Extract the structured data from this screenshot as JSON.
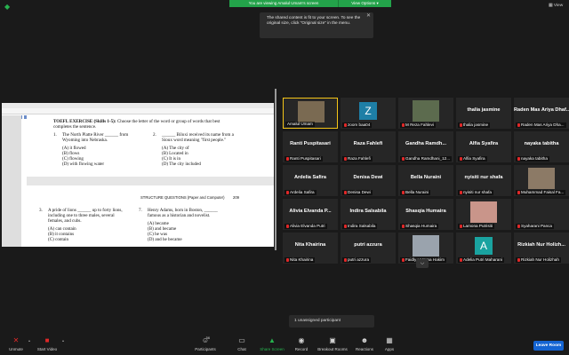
{
  "top": {
    "banner": "You are viewing Amalul Umam's screen",
    "view_options": "View Options ▾",
    "view": "View",
    "tooltip": "The shared content is fit to your screen. To see the original size, click \"Original size\" in the menu."
  },
  "doc": {
    "title_bold": "TOEFL EXERCISE (Skills 1-5):",
    "title_rest": "Choose the letter of the word or group of words that best",
    "title_line2": "completes the sentence.",
    "q1": [
      "1.",
      "The North Platte River ______ from",
      "Wyoming into Nebraska."
    ],
    "q1_opts": [
      "(A)  it flowed",
      "(B)  flows",
      "(C)  flowing",
      "(D)  with flowing water"
    ],
    "q2": [
      "2.",
      "______ Biloxi received its name from a",
      "Sioux word meaning \"first people.\""
    ],
    "q2_opts": [
      "(A)  The city of",
      "(B)  Located in",
      "(C)  It is in",
      "(D)  The city included"
    ],
    "section": "STRUCTURE QUESTIONS (Paper and Computer)",
    "page": "209",
    "q3": [
      "3.",
      "A pride of lions ______ up to forty lions,",
      "including one to three males, several",
      "females, and cubs."
    ],
    "q3_opts": [
      "(A)  can contain",
      "(B)  it contains",
      "(C)  contain"
    ],
    "q4": [
      "7.",
      "Henry Adams, born in Boston, ______",
      "famous as a historian and novelist."
    ],
    "q4_opts": [
      "(A)  became",
      "(B)  and became",
      "(C)  he was",
      "(D)  and he became"
    ]
  },
  "gallery": [
    {
      "name": "",
      "label": "Amalul Umam",
      "muted": false,
      "kind": "photo",
      "photo_color": "#7a6a52",
      "active": true
    },
    {
      "name": "",
      "label": "zoom baa04",
      "muted": true,
      "kind": "avatar",
      "avatar": "Z",
      "avatar_color": "#1e7fa6"
    },
    {
      "name": "",
      "label": "M Reza Fahlevi",
      "muted": true,
      "kind": "photo",
      "photo_color": "#5c6b4e"
    },
    {
      "name": "thalia jasmine",
      "label": "thalia jasmine",
      "muted": true
    },
    {
      "name": "Raden Mas Ariya Dhaf...",
      "label": "Raden Mas Ariya Dha...",
      "muted": true
    },
    {
      "name": "Ranti Puspitasari",
      "label": "Ranti Puspitasari",
      "muted": true
    },
    {
      "name": "Raza Fahlefi",
      "label": "Raza Fahlefi",
      "muted": true
    },
    {
      "name": "Gandha Ramdh...",
      "label": "Gandha Ramdhani_12...",
      "muted": true
    },
    {
      "name": "Alfia Syafira",
      "label": "Alfia Syafira",
      "muted": true
    },
    {
      "name": "nayaka tabitha",
      "label": "nayaka tabitha",
      "muted": true
    },
    {
      "name": "Ardelia Safira",
      "label": "Ardelia Safira",
      "muted": true
    },
    {
      "name": "Denisa Dewi",
      "label": "Denisa Dewi",
      "muted": true
    },
    {
      "name": "Bella Nuraini",
      "label": "Bella Nuraini",
      "muted": true
    },
    {
      "name": "nyisiti nur shafa",
      "label": "nyisiti nur shafa",
      "muted": true
    },
    {
      "name": "",
      "label": "Muhammad Faisal Fa...",
      "muted": true,
      "kind": "photo",
      "photo_color": "#8c7a66"
    },
    {
      "name": "Alivia Elvanda P...",
      "label": "Alivia Elvanda Putri",
      "muted": true
    },
    {
      "name": "Indira Salsabila",
      "label": "Indira Salsabila",
      "muted": true
    },
    {
      "name": "Shasqia Humaira",
      "label": "Shasqia Humaira",
      "muted": true
    },
    {
      "name": "",
      "label": "Lamona Putrisiti",
      "muted": true,
      "kind": "photo",
      "photo_color": "#c9958a"
    },
    {
      "name": "",
      "label": "Syaharani Panca",
      "muted": true,
      "kind": "blank"
    },
    {
      "name": "Nita Khairina",
      "label": "Nita Khairina",
      "muted": true
    },
    {
      "name": "putri azzura",
      "label": "putri azzura",
      "muted": true
    },
    {
      "name": "",
      "label": "Faidly Hutama Hakim",
      "muted": true,
      "kind": "photo",
      "photo_color": "#9aa3ad"
    },
    {
      "name": "",
      "label": "Adelia Putri Maharani",
      "muted": true,
      "kind": "avatar",
      "avatar": "A",
      "avatar_color": "#1aa3a0"
    },
    {
      "name": "Rizkiah Nur Holizh...",
      "label": "Rizkiah Nur Holizhah",
      "muted": true
    }
  ],
  "unassigned": "1 unassigned participant",
  "toolbar": {
    "unmute": "Unmute",
    "start_video": "Start Video",
    "participants": "Participants",
    "participants_count": "56",
    "chat": "Chat",
    "share_screen": "Share Screen",
    "record": "Record",
    "breakout": "Breakout Rooms",
    "reactions": "Reactions",
    "apps": "Apps",
    "leave": "Leave Room"
  },
  "colors": {
    "accent_green": "#23a34a",
    "leave_blue": "#1464d2",
    "muted_red": "#e02828",
    "active_border": "#f5c518"
  }
}
